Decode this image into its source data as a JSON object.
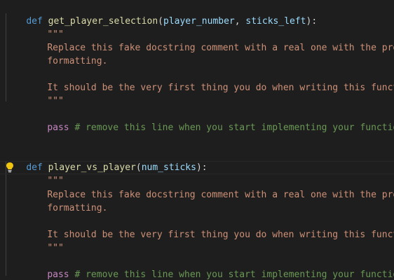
{
  "func1": {
    "def_kw": "def",
    "name": "get_player_selection",
    "open_paren": "(",
    "param1": "player_number",
    "comma": ", ",
    "param2": "sticks_left",
    "close": "):",
    "doc_open": "\"\"\"",
    "doc_line1": "Replace this fake docstring comment with a real one with the proper",
    "doc_line2": "formatting.",
    "doc_line3": "It should be the very first thing you do when writing this function.",
    "doc_close": "\"\"\"",
    "pass_kw": "pass",
    "comment": "# remove this line when you start implementing your function"
  },
  "func2": {
    "def_kw": "def",
    "name": "player_vs_player",
    "open_paren": "(",
    "param1": "num_sticks",
    "close": "):",
    "doc_open": "\"\"\"",
    "doc_line1": "Replace this fake docstring comment with a real one with the proper",
    "doc_line2": "formatting.",
    "doc_line3": "It should be the very first thing you do when writing this function.",
    "doc_close": "\"\"\"",
    "pass_kw": "pass",
    "comment": "# remove this line when you start implementing your function"
  },
  "lightbulb_icon": "lightbulb-icon",
  "colors": {
    "background": "#1e1e1e",
    "keyword": "#569cd6",
    "function": "#dcdcaa",
    "parameter": "#9cdcfe",
    "string": "#ce9178",
    "control": "#c586c0",
    "comment": "#6a9955",
    "lightbulb": "#f1c40f"
  }
}
